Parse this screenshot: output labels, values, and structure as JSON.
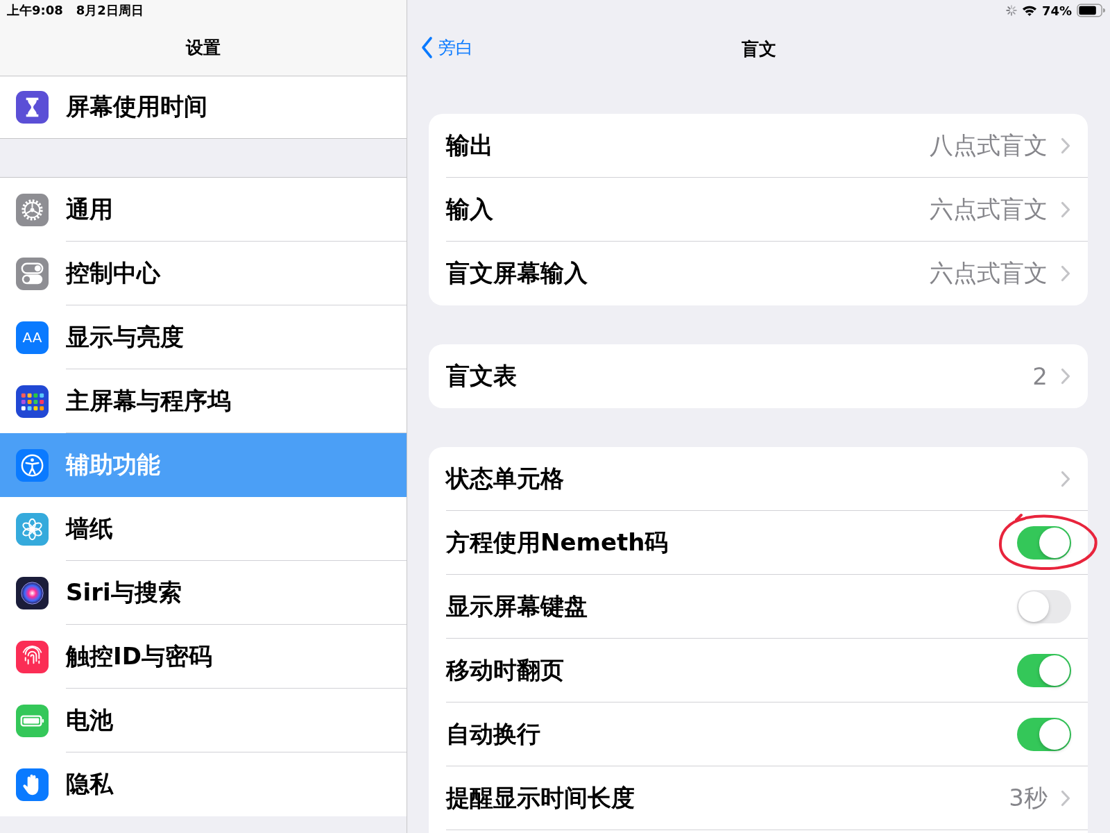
{
  "status_bar": {
    "time": "上午9:08",
    "date": "8月2日周日",
    "battery": "74%"
  },
  "sidebar": {
    "title": "设置",
    "groups": [
      {
        "items": [
          {
            "label": "屏幕使用时间",
            "color": "#5b4fd6",
            "selected": false
          }
        ]
      },
      {
        "items": [
          {
            "label": "通用",
            "color": "#8e8e93",
            "selected": false
          },
          {
            "label": "控制中心",
            "color": "#8e8e93",
            "selected": false
          },
          {
            "label": "显示与亮度",
            "color": "#0a7aff",
            "selected": false,
            "icon_text": "AA"
          },
          {
            "label": "主屏幕与程序坞",
            "color": "#2148d4",
            "selected": false
          },
          {
            "label": "辅助功能",
            "color": "#0a7aff",
            "selected": true
          },
          {
            "label": "墙纸",
            "color": "#35aadc",
            "selected": false
          },
          {
            "label": "Siri与搜索",
            "color": "#1b1d3a",
            "selected": false
          },
          {
            "label": "触控ID与密码",
            "color": "#fb2d55",
            "selected": false
          },
          {
            "label": "电池",
            "color": "#34c759",
            "selected": false
          },
          {
            "label": "隐私",
            "color": "#0a7aff",
            "selected": false
          }
        ]
      }
    ]
  },
  "detail": {
    "back": "旁白",
    "title": "盲文",
    "groups": [
      {
        "rows": [
          {
            "kind": "link",
            "label": "输出",
            "value": "八点式盲文"
          },
          {
            "kind": "link",
            "label": "输入",
            "value": "六点式盲文"
          },
          {
            "kind": "link",
            "label": "盲文屏幕输入",
            "value": "六点式盲文"
          }
        ]
      },
      {
        "rows": [
          {
            "kind": "link",
            "label": "盲文表",
            "value": "2"
          }
        ]
      },
      {
        "rows": [
          {
            "kind": "link",
            "label": "状态单元格",
            "circled": false
          },
          {
            "kind": "toggle",
            "label": "方程使用Nemeth码",
            "on": true,
            "circled": true
          },
          {
            "kind": "toggle",
            "label": "显示屏幕键盘",
            "on": false,
            "circled": false
          },
          {
            "kind": "toggle",
            "label": "移动时翻页",
            "on": true,
            "circled": false
          },
          {
            "kind": "toggle",
            "label": "自动换行",
            "on": true,
            "circled": false
          },
          {
            "kind": "link",
            "label": "提醒显示时间长度",
            "value": "3秒",
            "circled": false
          }
        ]
      }
    ]
  }
}
